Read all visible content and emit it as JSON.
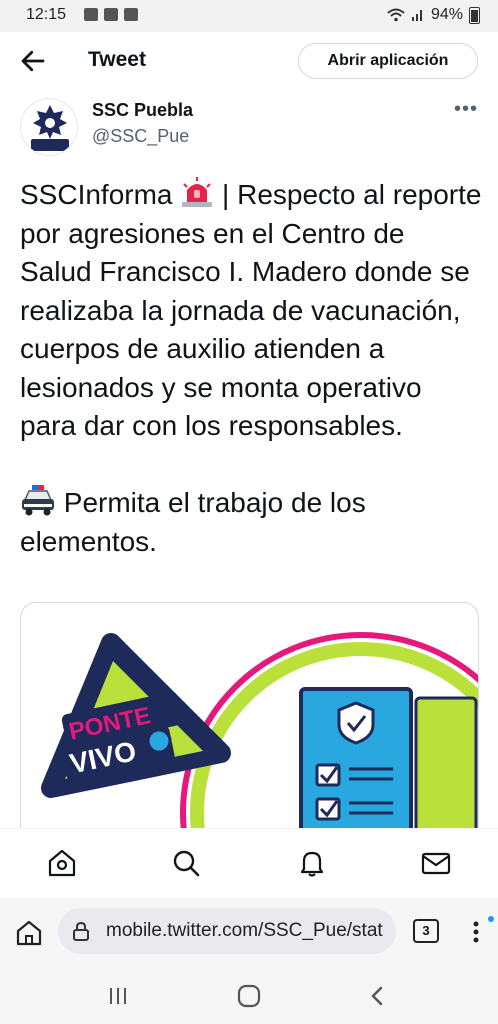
{
  "status_bar": {
    "time": "12:15",
    "battery": "94%",
    "icons": [
      "gallery-icon",
      "facebook-icon",
      "youtube-icon",
      "wifi-icon",
      "signal-icon",
      "battery-icon"
    ]
  },
  "header": {
    "title": "Tweet",
    "open_app_label": "Abrir aplicación"
  },
  "author": {
    "name": "SSC Puebla",
    "handle": "@SSC_Pue",
    "more": "•••"
  },
  "tweet": {
    "paragraph1_before": "SSCInforma ",
    "paragraph1_after": " | Respecto al reporte por agresiones en el Centro de Salud Francisco I. Madero donde se realizaba la jornada de vacunación, cuerpos de auxilio atienden a lesionados y se monta operativo para dar con los responsables.",
    "paragraph2": " Permita el trabajo de los elementos."
  },
  "media": {
    "logo_line1": "PONTE",
    "logo_line2": "VIVO"
  },
  "browser": {
    "url": "mobile.twitter.com/SSC_Pue/stat",
    "tabs_count": "3"
  },
  "colors": {
    "accent": "#1d9bf0",
    "text": "#0f1419",
    "secondary": "#536471",
    "logo_pink": "#e5197a",
    "logo_lime": "#b9e03b",
    "logo_navy": "#1e2a5a",
    "doc_blue": "#29a8e0"
  }
}
